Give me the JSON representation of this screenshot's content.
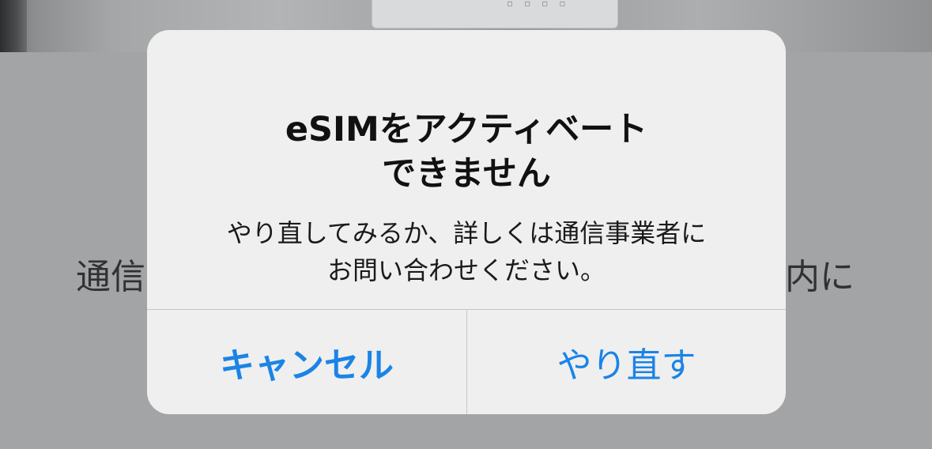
{
  "background": {
    "text_left": "通信",
    "text_right": "内に"
  },
  "alert": {
    "title_line1": "eSIMをアクティベート",
    "title_line2": "できません",
    "message_line1": "やり直してみるか、詳しくは通信事業者に",
    "message_line2": "お問い合わせください。",
    "buttons": {
      "cancel": "キャンセル",
      "retry": "やり直す"
    }
  },
  "colors": {
    "accent": "#1a84e6",
    "dialog_background": "#efefef",
    "dim_background": "#a3a4a5"
  }
}
